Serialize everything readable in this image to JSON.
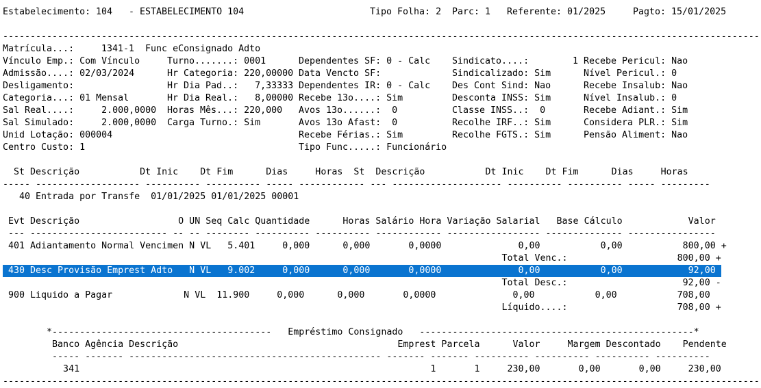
{
  "header": {
    "estab_label": "Estabelecimento:",
    "estab_code": "104",
    "estab_name": "- ESTABELECIMENTO 104",
    "tipo_folha": "Tipo Folha: 2",
    "parc": "Parc: 1",
    "referente": "Referente: 01/2025",
    "pagto": "Pagto: 15/01/2025"
  },
  "rule_long": "-------------------------------------------------------------------------------------------------------------------------------------------",
  "employee": {
    "matricula_label": "Matrícula...:",
    "matricula_value": "1341-1  Func eConsignado Adto",
    "col1": [
      "Vínculo Emp.: Com Vínculo",
      "Admissão....: 02/03/2024",
      "Desligamento:",
      "Categoria...: 01 Mensal",
      "Sal Real....:     2.000,0000",
      "Sal Simulado:     2.000,0000",
      "Unid Lotação: 000004",
      "Centro Custo: 1"
    ],
    "col2": [
      "Turno.......: 0001",
      "Hr Categoria: 220,00000",
      "Hr Dia Pad..:   7,33333",
      "Hr Dia Real.:   8,00000",
      "Horas Mês...: 220,000",
      "Carga Turno.: Sim"
    ],
    "col3": [
      "Dependentes SF: 0 - Calc",
      "Data Vencto SF:",
      "Dependentes IR: 0 - Calc",
      "Recebe 13o....: Sim",
      "Avos 13o......:  0",
      "Avos 13o Afast:  0",
      "Recebe Férias.: Sim",
      "Tipo Func.....: Funcionário"
    ],
    "col4": [
      "Sindicato....:",
      "Sindicalizado: Sim",
      "Des Cont Sind: Nao",
      "Desconta INSS: Sim",
      "Classe INSS..:  0",
      "Recolhe IRF..: Sim",
      "Recolhe FGTS.: Sim"
    ],
    "col5": [
      "1 Recebe Pericul: Nao",
      "  Nível Pericul.: 0",
      "  Recebe Insalub: Nao",
      "  Nível Insalub.: 0",
      "  Recebe Adiant.: Sim",
      "  Considera PLR.: Sim",
      "  Pensão Aliment: Nao"
    ]
  },
  "afast": {
    "header": "  St Descrição           Dt Inic    Dt Fim      Dias     Horas  St  Descrição           Dt Inic    Dt Fim      Dias     Horas",
    "dashes": "----- ------------------- ---------- ---------- ----- ------------ --- -------------------- ---------- ---------- ----- ---------",
    "row": "   40 Entrada por Transfe  01/01/2025 01/01/2025 00001"
  },
  "events": {
    "header": " Evt Descrição                  O UN Seq Calc Quantidade      Horas Salário Hora Variação Salarial   Base Cálculo            Valor",
    "dashes": " --- ------------------------- -- -- -------- ---------- ---------- ------------ ----------------- -------------- ----------------",
    "row1": " 401 Adiantamento Normal Vencimen N VL   5.401     0,000      0,000       0,0000              0,00           0,00           800,00 +",
    "total_venc": "                                                                                           Total Venc.:                    800,00 +",
    "row_selected": " 430 Desc Provisão Emprest Adto   N VL   9.002     0,000      0,000       0,0000              0,00           0,00            92,00 -",
    "total_desc": "                                                                                           Total Desc.:                     92,00 -",
    "row3": " 900 Liquido a Pagar             N VL  11.900     0,000      0,000       0,0000              0,00           0,00           708,00",
    "liquido": "                                                                                           Líquido....:                    708,00 +"
  },
  "consignado": {
    "title_line": "        *----------------------------------------   Empréstimo Consignado   --------------------------------------------------*",
    "header": "         Banco Agência Descrição                                        Emprest Parcela      Valor     Margem Descontado    Pendente",
    "dashes": "         ----- ------- ---------------------------------------------- ------- ------- ---------- ---------- ---------- ----------",
    "row": "           341                                                                1       1     230,00       0,00       0,00     230,00"
  },
  "colors": {
    "selection": "#0a74d0",
    "selection_text": "#ffffff"
  }
}
